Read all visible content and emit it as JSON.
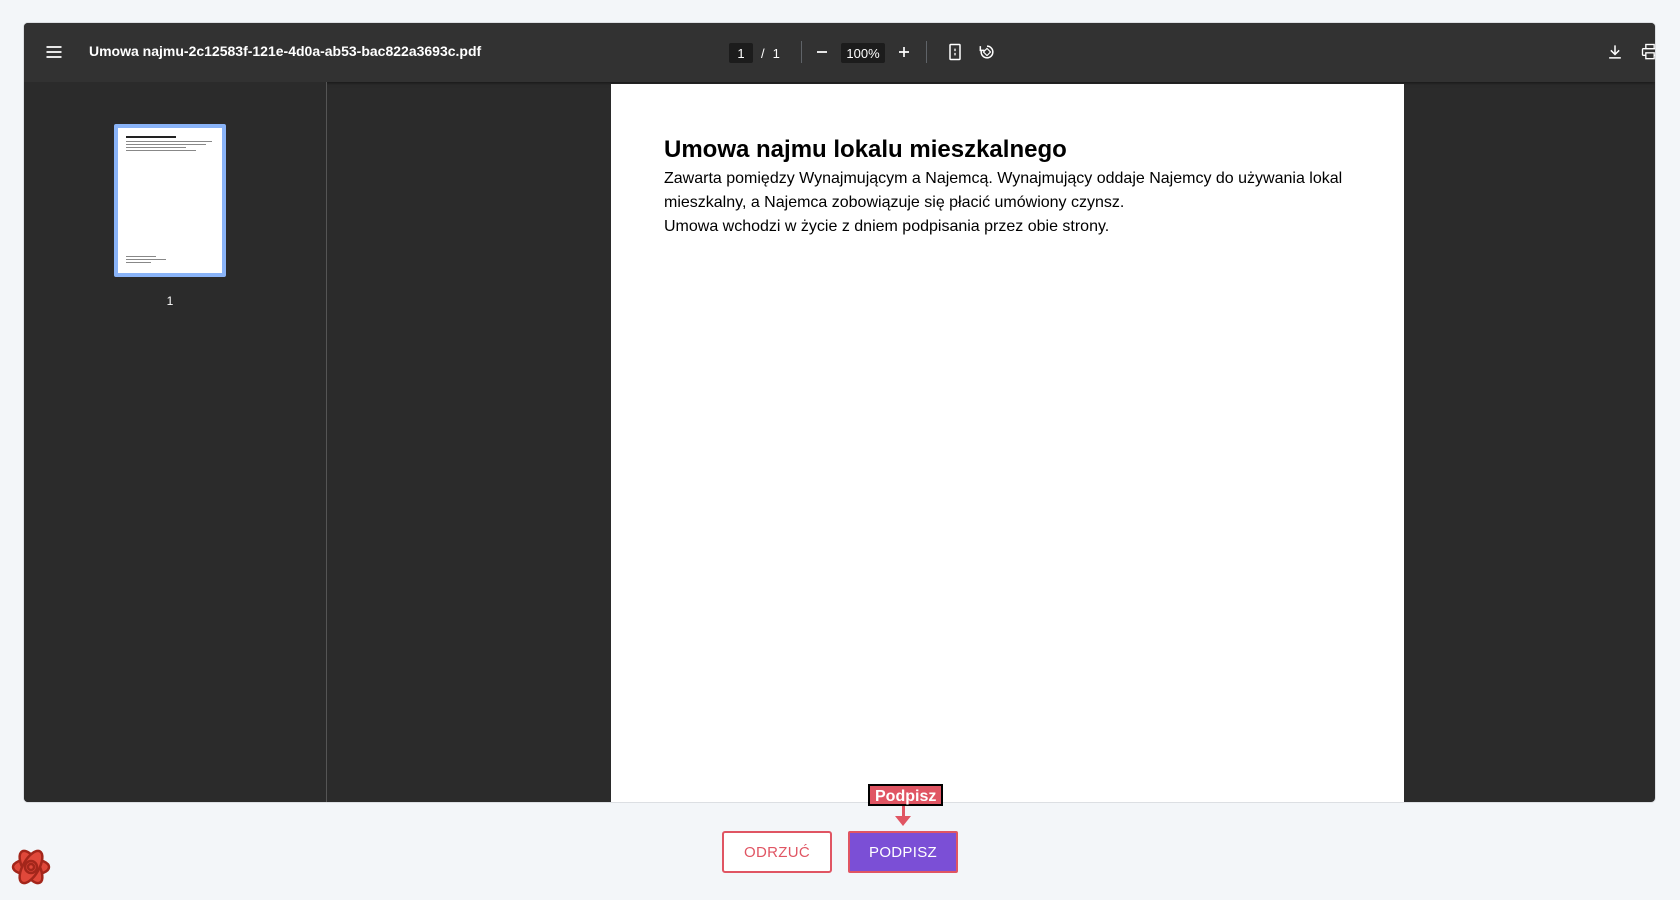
{
  "viewer": {
    "filename": "Umowa najmu-2c12583f-121e-4d0a-ab53-bac822a3693c.pdf",
    "current_page": "1",
    "page_separator": "/",
    "total_pages": "1",
    "zoom": "100%",
    "icons": {
      "menu": "menu-icon",
      "zoom_out": "minus-icon",
      "zoom_in": "plus-icon",
      "fit": "fit-page-icon",
      "rotate": "rotate-icon",
      "download": "download-icon",
      "print": "print-icon"
    }
  },
  "sidebar": {
    "thumbnail_label": "1"
  },
  "document": {
    "title": "Umowa najmu lokalu mieszkalnego",
    "paragraphs": [
      "Zawarta pomiędzy Wynajmującym a Najemcą. Wynajmujący oddaje Najemcy do używania lokal mieszkalny, a Najemca zobowiązuje się płacić umówiony czynsz.",
      "Umowa wchodzi w życie z dniem podpisania przez obie strony."
    ]
  },
  "actions": {
    "reject_label": "ODRZUĆ",
    "sign_label": "PODPISZ",
    "tooltip_label": "Podpisz"
  },
  "colors": {
    "accent": "#7b4fd6",
    "danger": "#e05563",
    "viewer_bg": "#2b2b2b",
    "toolbar_bg": "#323232",
    "page_bg": "#f3f6f9"
  }
}
